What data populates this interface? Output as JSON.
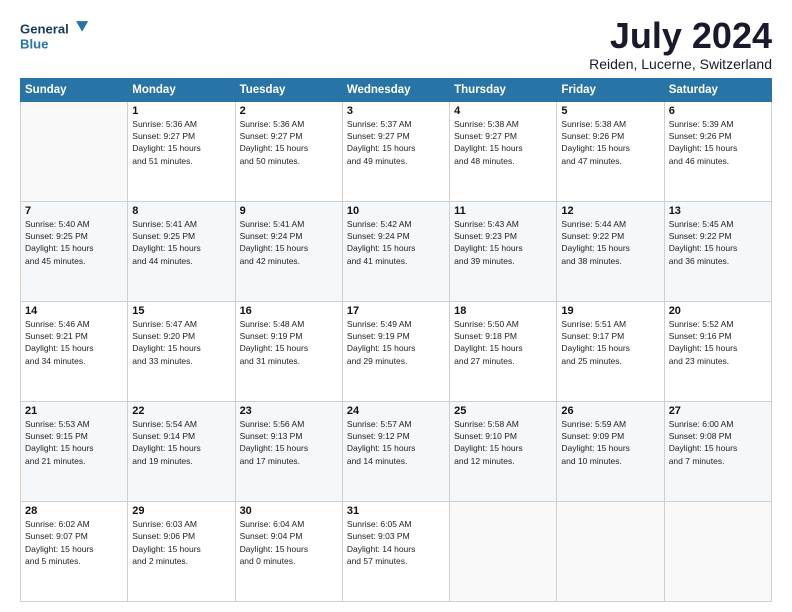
{
  "logo": {
    "line1": "General",
    "line2": "Blue"
  },
  "title": {
    "month_year": "July 2024",
    "location": "Reiden, Lucerne, Switzerland"
  },
  "days_of_week": [
    "Sunday",
    "Monday",
    "Tuesday",
    "Wednesday",
    "Thursday",
    "Friday",
    "Saturday"
  ],
  "weeks": [
    [
      {
        "day": "",
        "info": ""
      },
      {
        "day": "1",
        "info": "Sunrise: 5:36 AM\nSunset: 9:27 PM\nDaylight: 15 hours\nand 51 minutes."
      },
      {
        "day": "2",
        "info": "Sunrise: 5:36 AM\nSunset: 9:27 PM\nDaylight: 15 hours\nand 50 minutes."
      },
      {
        "day": "3",
        "info": "Sunrise: 5:37 AM\nSunset: 9:27 PM\nDaylight: 15 hours\nand 49 minutes."
      },
      {
        "day": "4",
        "info": "Sunrise: 5:38 AM\nSunset: 9:27 PM\nDaylight: 15 hours\nand 48 minutes."
      },
      {
        "day": "5",
        "info": "Sunrise: 5:38 AM\nSunset: 9:26 PM\nDaylight: 15 hours\nand 47 minutes."
      },
      {
        "day": "6",
        "info": "Sunrise: 5:39 AM\nSunset: 9:26 PM\nDaylight: 15 hours\nand 46 minutes."
      }
    ],
    [
      {
        "day": "7",
        "info": "Sunrise: 5:40 AM\nSunset: 9:25 PM\nDaylight: 15 hours\nand 45 minutes."
      },
      {
        "day": "8",
        "info": "Sunrise: 5:41 AM\nSunset: 9:25 PM\nDaylight: 15 hours\nand 44 minutes."
      },
      {
        "day": "9",
        "info": "Sunrise: 5:41 AM\nSunset: 9:24 PM\nDaylight: 15 hours\nand 42 minutes."
      },
      {
        "day": "10",
        "info": "Sunrise: 5:42 AM\nSunset: 9:24 PM\nDaylight: 15 hours\nand 41 minutes."
      },
      {
        "day": "11",
        "info": "Sunrise: 5:43 AM\nSunset: 9:23 PM\nDaylight: 15 hours\nand 39 minutes."
      },
      {
        "day": "12",
        "info": "Sunrise: 5:44 AM\nSunset: 9:22 PM\nDaylight: 15 hours\nand 38 minutes."
      },
      {
        "day": "13",
        "info": "Sunrise: 5:45 AM\nSunset: 9:22 PM\nDaylight: 15 hours\nand 36 minutes."
      }
    ],
    [
      {
        "day": "14",
        "info": "Sunrise: 5:46 AM\nSunset: 9:21 PM\nDaylight: 15 hours\nand 34 minutes."
      },
      {
        "day": "15",
        "info": "Sunrise: 5:47 AM\nSunset: 9:20 PM\nDaylight: 15 hours\nand 33 minutes."
      },
      {
        "day": "16",
        "info": "Sunrise: 5:48 AM\nSunset: 9:19 PM\nDaylight: 15 hours\nand 31 minutes."
      },
      {
        "day": "17",
        "info": "Sunrise: 5:49 AM\nSunset: 9:19 PM\nDaylight: 15 hours\nand 29 minutes."
      },
      {
        "day": "18",
        "info": "Sunrise: 5:50 AM\nSunset: 9:18 PM\nDaylight: 15 hours\nand 27 minutes."
      },
      {
        "day": "19",
        "info": "Sunrise: 5:51 AM\nSunset: 9:17 PM\nDaylight: 15 hours\nand 25 minutes."
      },
      {
        "day": "20",
        "info": "Sunrise: 5:52 AM\nSunset: 9:16 PM\nDaylight: 15 hours\nand 23 minutes."
      }
    ],
    [
      {
        "day": "21",
        "info": "Sunrise: 5:53 AM\nSunset: 9:15 PM\nDaylight: 15 hours\nand 21 minutes."
      },
      {
        "day": "22",
        "info": "Sunrise: 5:54 AM\nSunset: 9:14 PM\nDaylight: 15 hours\nand 19 minutes."
      },
      {
        "day": "23",
        "info": "Sunrise: 5:56 AM\nSunset: 9:13 PM\nDaylight: 15 hours\nand 17 minutes."
      },
      {
        "day": "24",
        "info": "Sunrise: 5:57 AM\nSunset: 9:12 PM\nDaylight: 15 hours\nand 14 minutes."
      },
      {
        "day": "25",
        "info": "Sunrise: 5:58 AM\nSunset: 9:10 PM\nDaylight: 15 hours\nand 12 minutes."
      },
      {
        "day": "26",
        "info": "Sunrise: 5:59 AM\nSunset: 9:09 PM\nDaylight: 15 hours\nand 10 minutes."
      },
      {
        "day": "27",
        "info": "Sunrise: 6:00 AM\nSunset: 9:08 PM\nDaylight: 15 hours\nand 7 minutes."
      }
    ],
    [
      {
        "day": "28",
        "info": "Sunrise: 6:02 AM\nSunset: 9:07 PM\nDaylight: 15 hours\nand 5 minutes."
      },
      {
        "day": "29",
        "info": "Sunrise: 6:03 AM\nSunset: 9:06 PM\nDaylight: 15 hours\nand 2 minutes."
      },
      {
        "day": "30",
        "info": "Sunrise: 6:04 AM\nSunset: 9:04 PM\nDaylight: 15 hours\nand 0 minutes."
      },
      {
        "day": "31",
        "info": "Sunrise: 6:05 AM\nSunset: 9:03 PM\nDaylight: 14 hours\nand 57 minutes."
      },
      {
        "day": "",
        "info": ""
      },
      {
        "day": "",
        "info": ""
      },
      {
        "day": "",
        "info": ""
      }
    ]
  ]
}
